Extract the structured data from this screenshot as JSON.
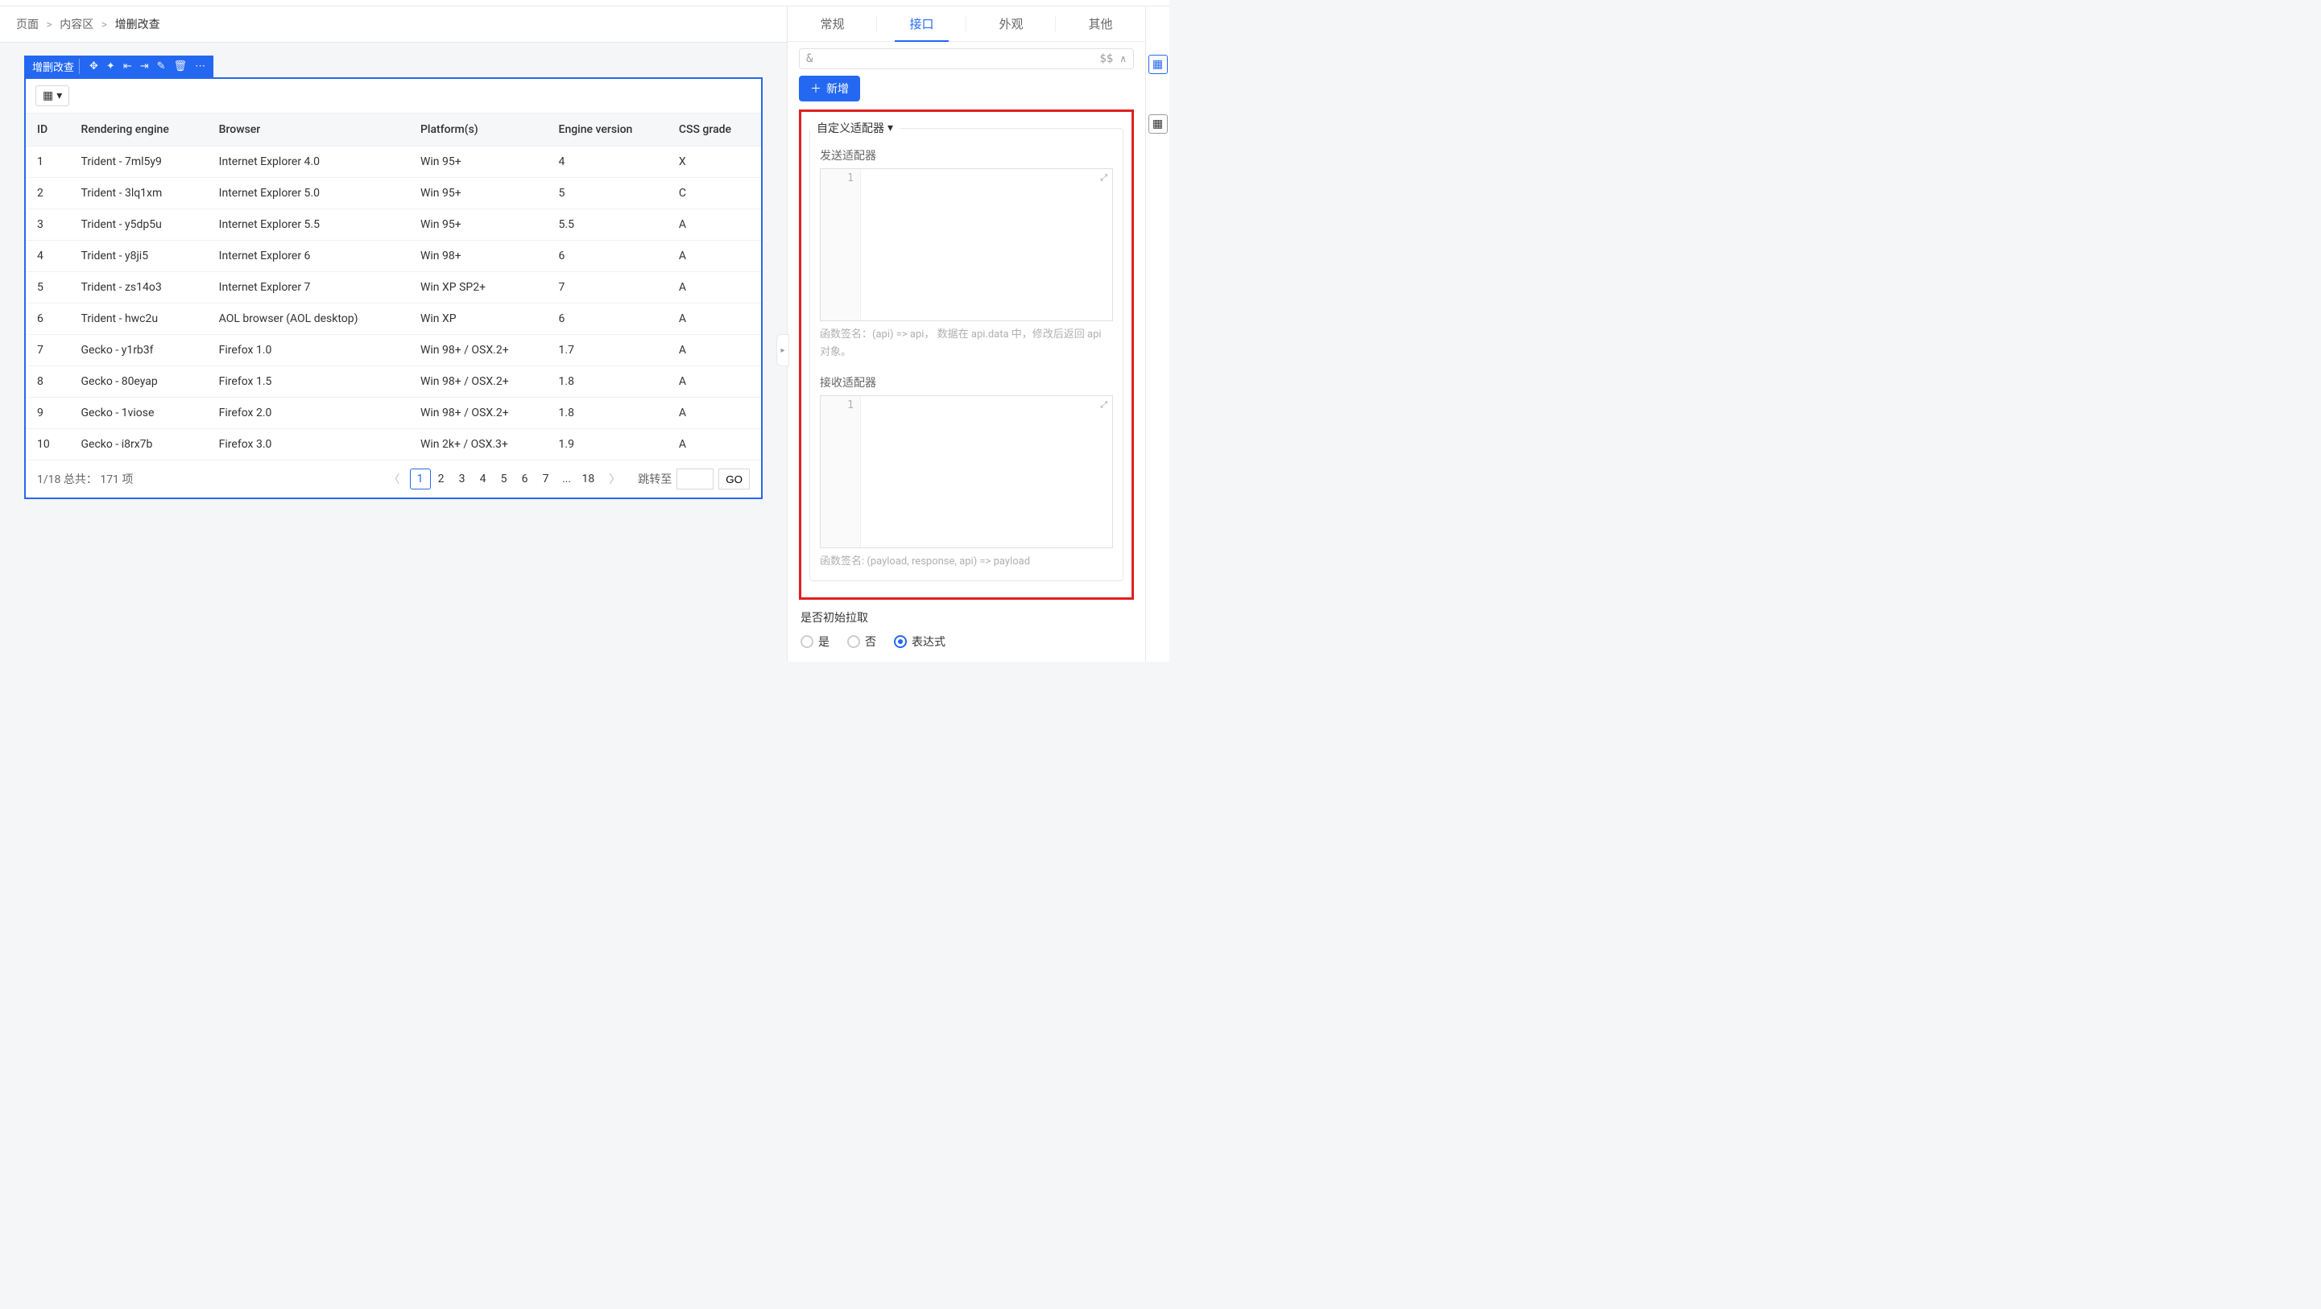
{
  "breadcrumb": {
    "items": [
      "页面",
      "内容区",
      "增删改查"
    ],
    "sep": ">"
  },
  "component": {
    "title": "增删改查",
    "toolbar_icons": [
      "move-icon",
      "insert-icon",
      "align-left-icon",
      "align-right-icon",
      "edit-icon",
      "delete-icon",
      "more-icon"
    ]
  },
  "table": {
    "columns": [
      "ID",
      "Rendering engine",
      "Browser",
      "Platform(s)",
      "Engine version",
      "CSS grade"
    ],
    "rows": [
      [
        "1",
        "Trident - 7ml5y9",
        "Internet Explorer 4.0",
        "Win 95+",
        "4",
        "X"
      ],
      [
        "2",
        "Trident - 3lq1xm",
        "Internet Explorer 5.0",
        "Win 95+",
        "5",
        "C"
      ],
      [
        "3",
        "Trident - y5dp5u",
        "Internet Explorer 5.5",
        "Win 95+",
        "5.5",
        "A"
      ],
      [
        "4",
        "Trident - y8ji5",
        "Internet Explorer 6",
        "Win 98+",
        "6",
        "A"
      ],
      [
        "5",
        "Trident - zs14o3",
        "Internet Explorer 7",
        "Win XP SP2+",
        "7",
        "A"
      ],
      [
        "6",
        "Trident - hwc2u",
        "AOL browser (AOL desktop)",
        "Win XP",
        "6",
        "A"
      ],
      [
        "7",
        "Gecko - y1rb3f",
        "Firefox 1.0",
        "Win 98+ / OSX.2+",
        "1.7",
        "A"
      ],
      [
        "8",
        "Gecko - 80eyap",
        "Firefox 1.5",
        "Win 98+ / OSX.2+",
        "1.8",
        "A"
      ],
      [
        "9",
        "Gecko - 1viose",
        "Firefox 2.0",
        "Win 98+ / OSX.2+",
        "1.8",
        "A"
      ],
      [
        "10",
        "Gecko - i8rx7b",
        "Firefox 3.0",
        "Win 2k+ / OSX.3+",
        "1.9",
        "A"
      ]
    ],
    "footer_summary": "1/18 总共： 171 项",
    "pages": [
      "1",
      "2",
      "3",
      "4",
      "5",
      "6",
      "7",
      "...",
      "18"
    ],
    "active_page": "1",
    "jump_label": "跳转至",
    "go_label": "GO"
  },
  "right_panel": {
    "tabs": [
      "常规",
      "接口",
      "外观",
      "其他"
    ],
    "active_tab": "接口",
    "expr_prefix": "&",
    "expr_suffix": "$$",
    "add_btn": "新增",
    "custom_adapter_title": "自定义适配器",
    "send_adapter_label": "发送适配器",
    "send_adapter_line": "1",
    "send_adapter_hint": "函数签名：(api) => api， 数据在 api.data 中，修改后返回 api 对象。",
    "recv_adapter_label": "接收适配器",
    "recv_adapter_line": "1",
    "recv_adapter_hint": "函数签名: (payload, response, api) => payload",
    "init_fetch_label": "是否初始拉取",
    "radio_options": [
      "是",
      "否",
      "表达式"
    ],
    "radio_selected": "表达式"
  }
}
